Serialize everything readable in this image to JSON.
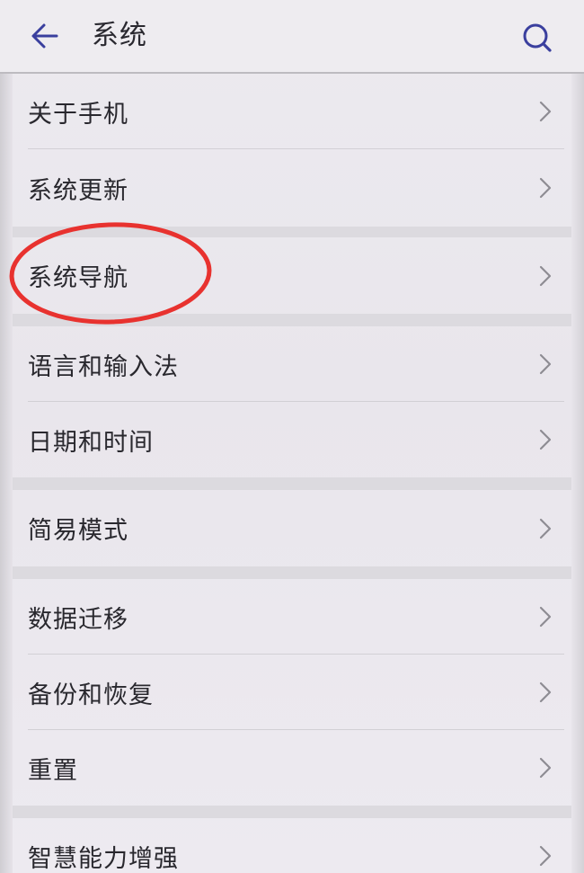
{
  "header": {
    "title": "系统",
    "back_icon": "arrow-left-icon",
    "search_icon": "search-icon"
  },
  "items": [
    {
      "label": "关于手机"
    },
    {
      "label": "系统更新"
    },
    {
      "label": "系统导航"
    },
    {
      "label": "语言和输入法"
    },
    {
      "label": "日期和时间"
    },
    {
      "label": "简易模式"
    },
    {
      "label": "数据迁移"
    },
    {
      "label": "备份和恢复"
    },
    {
      "label": "重置"
    },
    {
      "label": "智慧能力增强"
    }
  ],
  "colors": {
    "accent": "#3a3f9e",
    "annotation": "#e8322f",
    "text": "#29282e",
    "chevron": "#8e8c93"
  }
}
